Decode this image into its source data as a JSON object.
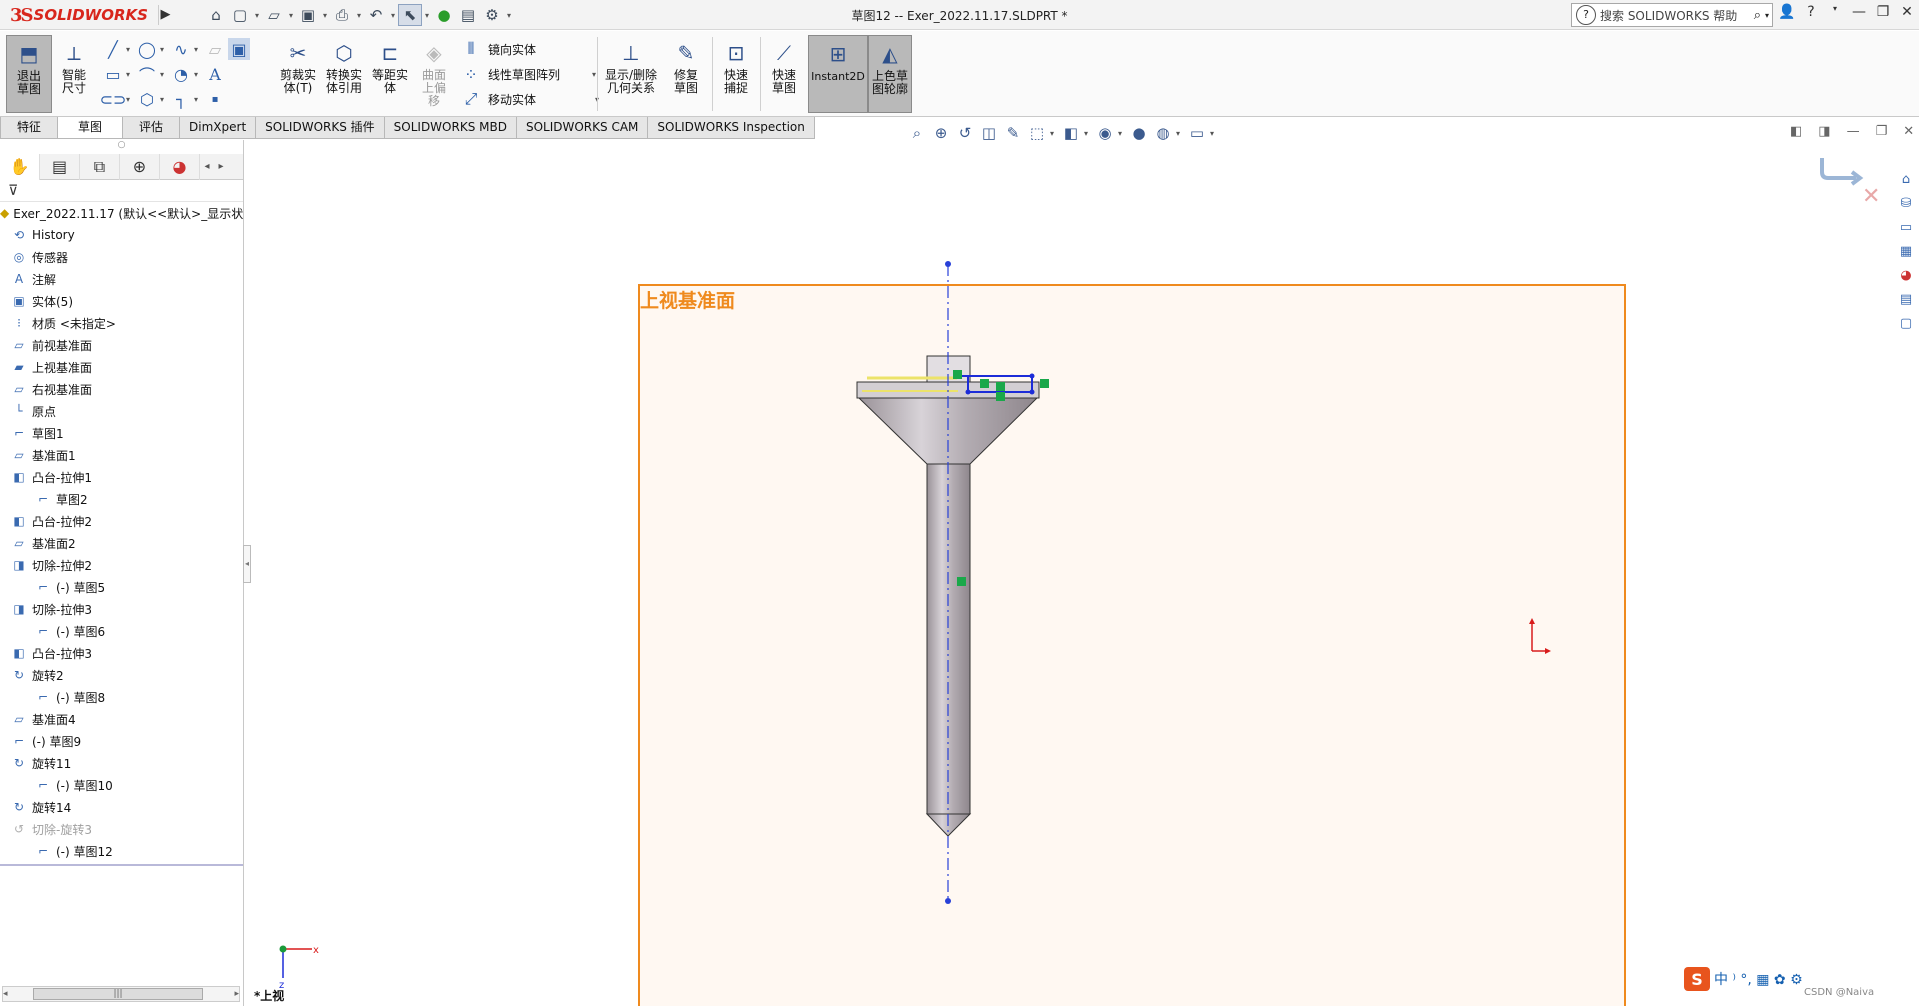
{
  "titlebar": {
    "brand": "SOLIDWORKS",
    "brand_prefix": "3S",
    "document_title": "草图12 -- Exer_2022.11.17.SLDPRT *",
    "search_placeholder": "搜索 SOLIDWORKS 帮助",
    "quick_access_icons": [
      "home-icon",
      "new-doc-icon",
      "open-icon",
      "save-icon",
      "print-icon",
      "undo-icon",
      "select-icon",
      "traffic-light-icon",
      "file-props-icon",
      "options-gear-icon"
    ]
  },
  "commandmanager": {
    "exit_sketch": "退出草图",
    "smart_dimension": "智能尺寸",
    "trim": "剪裁实体(T)",
    "convert": "转换实体引用",
    "offset": "等距实体",
    "surface_offset": "曲面上偏移",
    "mirror": "镜向实体",
    "linear_pattern": "线性草图阵列",
    "move": "移动实体",
    "display_relations": "显示/删除几何关系",
    "repair": "修复草图",
    "quick_snap": "快速捕捉",
    "rapid_sketch": "快速草图",
    "instant2d": "Instant2D",
    "shaded_contours": "上色草图轮廓"
  },
  "tabs": [
    "特征",
    "草图",
    "评估",
    "DimXpert",
    "SOLIDWORKS 插件",
    "SOLIDWORKS MBD",
    "SOLIDWORKS CAM",
    "SOLIDWORKS Inspection"
  ],
  "active_tab": "草图",
  "feature_tree": {
    "root": "Exer_2022.11.17  (默认<<默认>_显示状态",
    "nodes": [
      {
        "label": "History",
        "icon": "history-icon",
        "indent": 0
      },
      {
        "label": "传感器",
        "icon": "sensor-icon",
        "indent": 0
      },
      {
        "label": "注解",
        "icon": "annotation-icon",
        "indent": 0
      },
      {
        "label": "实体(5)",
        "icon": "solid-bodies-icon",
        "indent": 0
      },
      {
        "label": "材质 <未指定>",
        "icon": "material-icon",
        "indent": 0
      },
      {
        "label": "前视基准面",
        "icon": "plane-icon",
        "indent": 0
      },
      {
        "label": "上视基准面",
        "icon": "plane-selected-icon",
        "indent": 0
      },
      {
        "label": "右视基准面",
        "icon": "plane-icon",
        "indent": 0
      },
      {
        "label": "原点",
        "icon": "origin-icon",
        "indent": 0
      },
      {
        "label": "草图1",
        "icon": "sketch-icon",
        "indent": 0
      },
      {
        "label": "基准面1",
        "icon": "plane-icon",
        "indent": 0
      },
      {
        "label": "凸台-拉伸1",
        "icon": "extrude-icon",
        "indent": 0
      },
      {
        "label": "草图2",
        "icon": "sketch-icon",
        "indent": 1
      },
      {
        "label": "凸台-拉伸2",
        "icon": "extrude-icon",
        "indent": 0
      },
      {
        "label": "基准面2",
        "icon": "plane-icon",
        "indent": 0
      },
      {
        "label": "切除-拉伸2",
        "icon": "cut-extrude-icon",
        "indent": 0
      },
      {
        "label": "(-) 草图5",
        "icon": "sketch-icon",
        "indent": 1
      },
      {
        "label": "切除-拉伸3",
        "icon": "cut-extrude-icon",
        "indent": 0
      },
      {
        "label": "(-) 草图6",
        "icon": "sketch-icon",
        "indent": 1
      },
      {
        "label": "凸台-拉伸3",
        "icon": "extrude-icon",
        "indent": 0
      },
      {
        "label": "旋转2",
        "icon": "revolve-icon",
        "indent": 0
      },
      {
        "label": "(-) 草图8",
        "icon": "sketch-icon",
        "indent": 1
      },
      {
        "label": "基准面4",
        "icon": "plane-icon",
        "indent": 0
      },
      {
        "label": "(-) 草图9",
        "icon": "sketch-icon",
        "indent": 0
      },
      {
        "label": "旋转11",
        "icon": "revolve-icon",
        "indent": 0
      },
      {
        "label": "(-) 草图10",
        "icon": "sketch-icon",
        "indent": 1
      },
      {
        "label": "旋转14",
        "icon": "revolve-icon",
        "indent": 0
      },
      {
        "label": "切除-旋转3",
        "icon": "cut-revolve-icon",
        "indent": 0,
        "suppressed": true
      },
      {
        "label": "(-) 草图12",
        "icon": "sketch-icon",
        "indent": 1
      }
    ]
  },
  "graphics": {
    "plane_label": "上视基准面",
    "view_label": "*上视",
    "triad_x": "x",
    "triad_z": "z",
    "plane_color": "#ef8a1e",
    "ime_text": "中 ⁾ °, ▦ ✿ ⚙",
    "watermark": "CSDN @Naiva"
  }
}
